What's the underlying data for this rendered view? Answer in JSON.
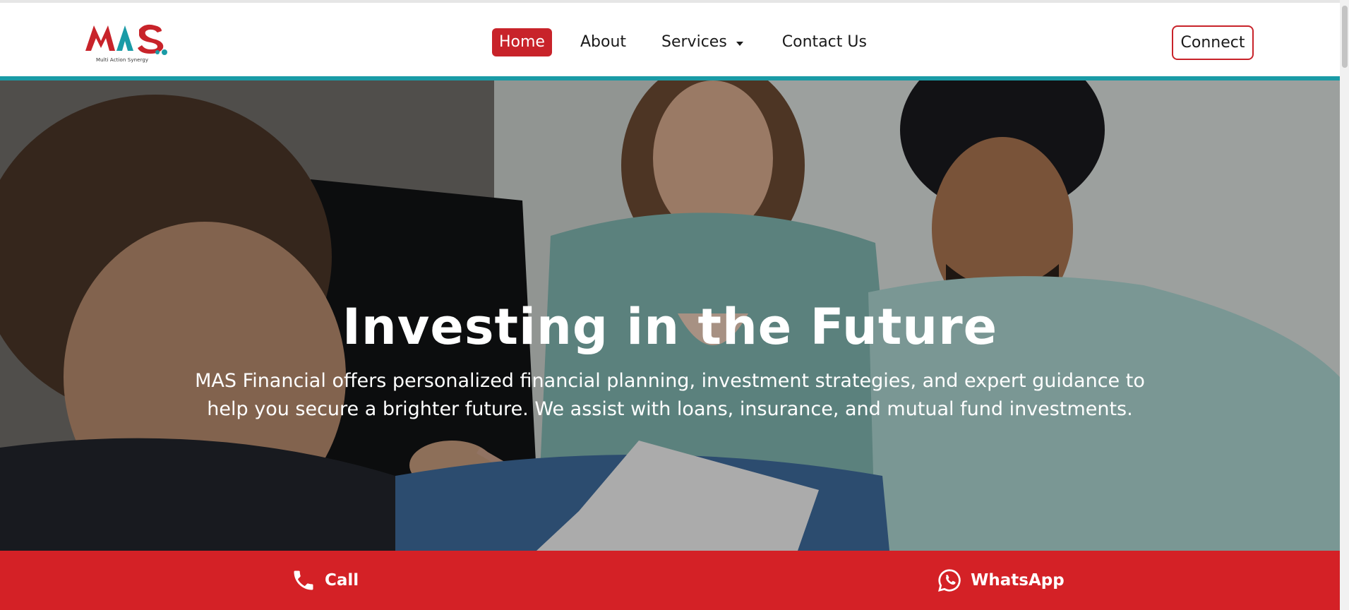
{
  "brand": {
    "logo_text": "MAS",
    "tagline": "Multi Action Synergy"
  },
  "nav": {
    "items": [
      {
        "label": "Home",
        "active": true
      },
      {
        "label": "About"
      },
      {
        "label": "Services",
        "has_dropdown": true
      },
      {
        "label": "Contact Us"
      }
    ],
    "connect_label": "Connect"
  },
  "hero": {
    "title": "Investing in the Future",
    "subtitle_line1": "MAS Financial offers personalized financial planning, investment strategies, and expert guidance to",
    "subtitle_line2": "help you secure a brighter future. We assist with loans, insurance, and mutual fund investments."
  },
  "bottom_bar": {
    "call_label": "Call",
    "whatsapp_label": "WhatsApp"
  },
  "colors": {
    "brand_red": "#c8232a",
    "brand_teal": "#1a9ba6",
    "bar_red": "#d42126"
  },
  "icons": [
    "phone-icon",
    "whatsapp-icon",
    "chevron-down-icon"
  ]
}
